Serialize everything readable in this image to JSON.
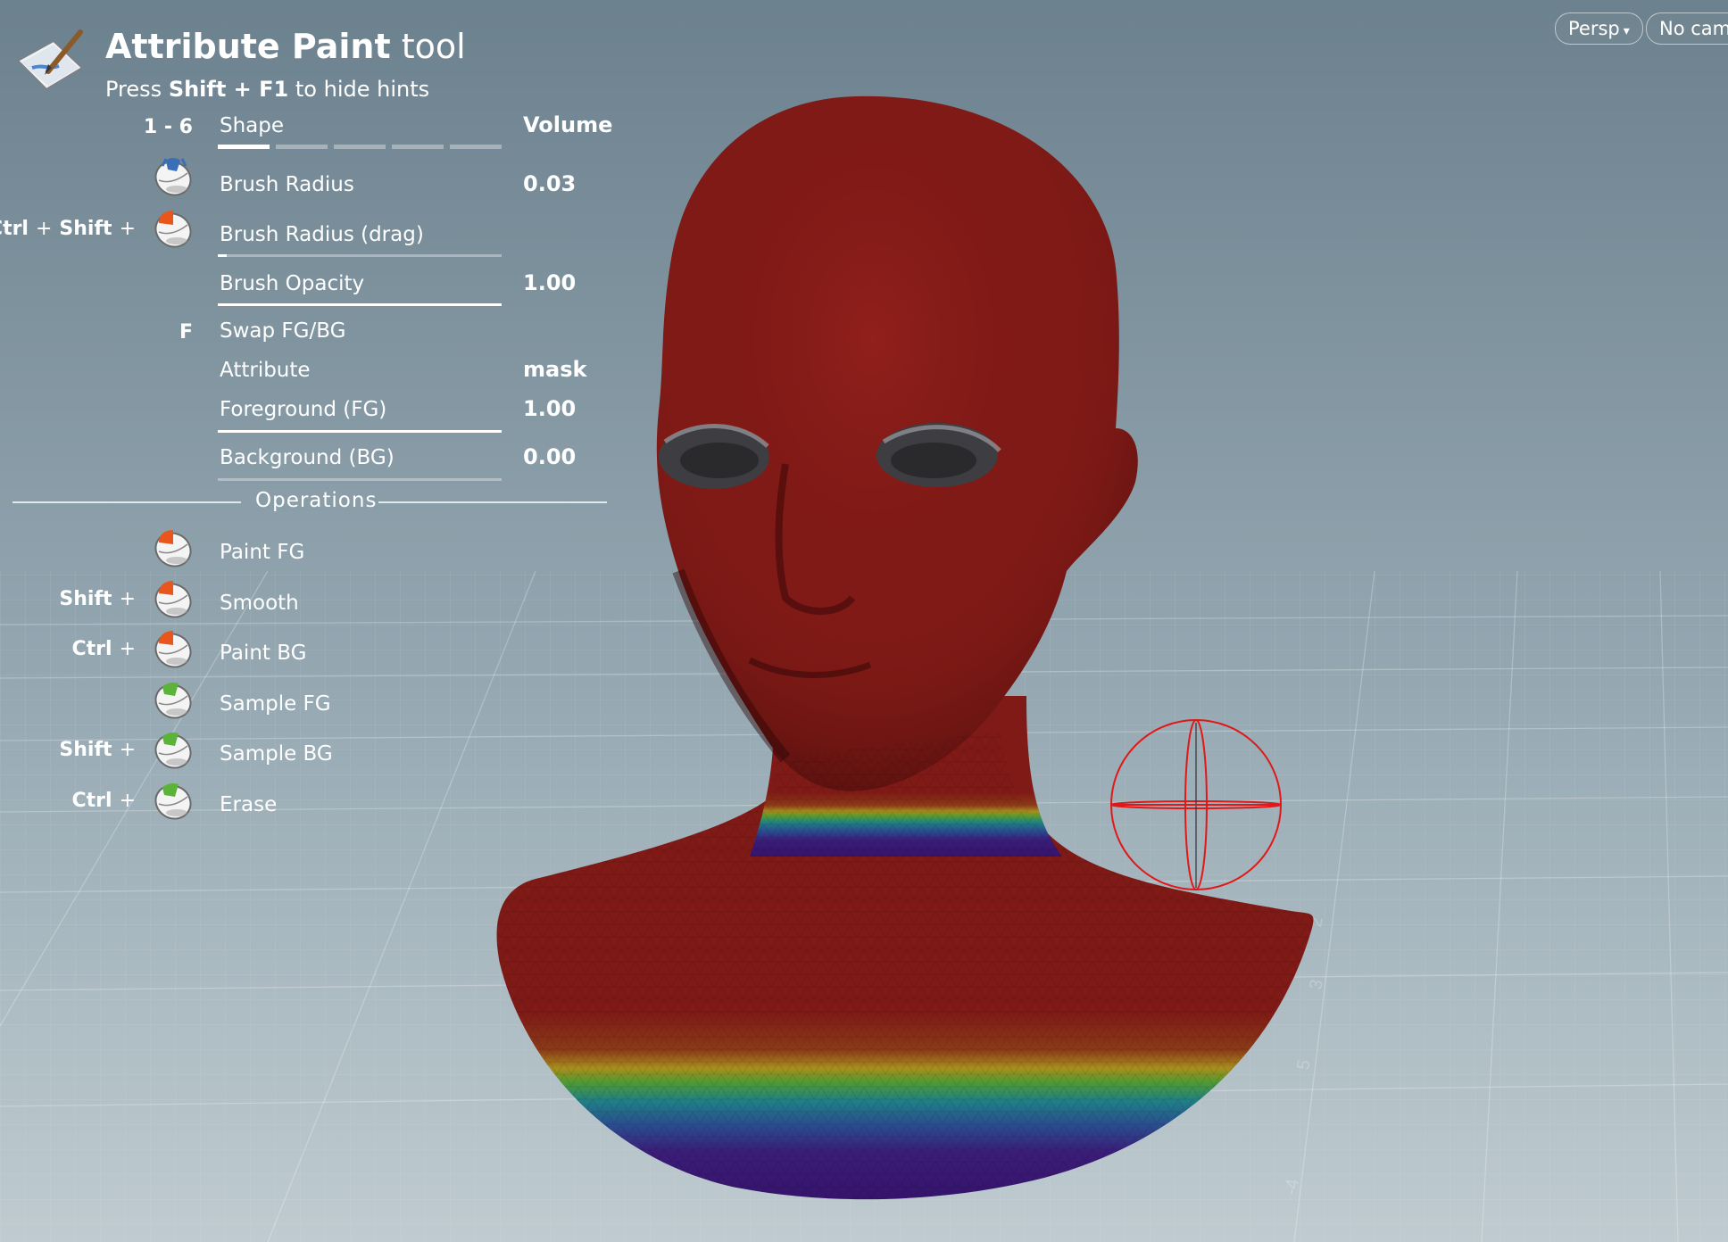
{
  "tool": {
    "title_bold": "Attribute Paint",
    "title_rest": "tool",
    "hint_prefix": "Press",
    "hint_keys": "Shift + F1",
    "hint_suffix": "to hide hints"
  },
  "viewport_buttons": {
    "persp": "Persp",
    "no_cam": "No cam"
  },
  "settings": {
    "shape": {
      "keys": "1 - 6",
      "label": "Shape",
      "value": "Volume",
      "selected_index": 0,
      "segments": 5
    },
    "brush_radius": {
      "label": "Brush Radius",
      "value": "0.03"
    },
    "brush_radius_drag": {
      "mod1": "Ctrl",
      "mod2": "Shift",
      "label": "Brush Radius (drag)",
      "fill": 0.03
    },
    "brush_opacity": {
      "label": "Brush Opacity",
      "value": "1.00",
      "fill": 1.0
    },
    "swap": {
      "key": "F",
      "label": "Swap FG/BG"
    },
    "attribute": {
      "label": "Attribute",
      "value": "mask"
    },
    "foreground": {
      "label": "Foreground (FG)",
      "value": "1.00",
      "fill": 1.0
    },
    "background": {
      "label": "Background (BG)",
      "value": "0.00",
      "fill": 0.0
    }
  },
  "operations": {
    "title": "Operations",
    "items": [
      {
        "mod": "",
        "label": "Paint FG",
        "button": "left-mouse-icon"
      },
      {
        "mod": "Shift",
        "label": "Smooth",
        "button": "left-mouse-icon"
      },
      {
        "mod": "Ctrl",
        "label": "Paint BG",
        "button": "left-mouse-icon"
      },
      {
        "mod": "",
        "label": "Sample FG",
        "button": "middle-mouse-icon"
      },
      {
        "mod": "Shift",
        "label": "Sample BG",
        "button": "middle-mouse-icon"
      },
      {
        "mod": "Ctrl",
        "label": "Erase",
        "button": "middle-mouse-icon"
      }
    ]
  },
  "colors": {
    "mask_high": "#8b1a17",
    "mask_low": "#3a1672",
    "left_button": "#e8561c",
    "middle_button": "#5bb33a",
    "brush_cursor": "#e01818"
  }
}
